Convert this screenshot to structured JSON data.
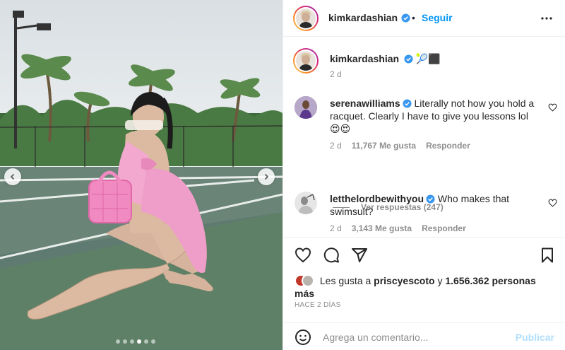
{
  "post": {
    "author": "kimkardashian",
    "follow_label": "Seguir",
    "more_icon": "more-horizontal-icon",
    "carousel": {
      "slide_count": 6,
      "active_slide": 4
    }
  },
  "caption": {
    "username": "kimkardashian",
    "emoji": "🎾⬛",
    "time": "2 d"
  },
  "comments": [
    {
      "username": "serenawilliams",
      "text": "Literally not how you hold a racquet. Clearly I have to give you lessons lol",
      "emoji": "😍😍",
      "time": "2 d",
      "likes": "11,767 Me gusta",
      "reply_label": "Responder",
      "view_replies": "Ver respuestas (247)"
    },
    {
      "username": "letthelordbewithyou",
      "text": "Who makes that swimsuit?",
      "time": "2 d",
      "likes": "3,143 Me gusta",
      "reply_label": "Responder"
    }
  ],
  "likes": {
    "prefix": "Les gusta a",
    "user": "priscyescoto",
    "conjunction": "y",
    "others": "1.656.362 personas más"
  },
  "timestamp": "HACE 2 DÍAS",
  "add_comment": {
    "placeholder": "Agrega un comentario...",
    "publish_label": "Publicar"
  },
  "colors": {
    "accent": "#0095f6",
    "text": "#262626",
    "muted": "#8e8e8e",
    "verified": "#3897f0"
  }
}
